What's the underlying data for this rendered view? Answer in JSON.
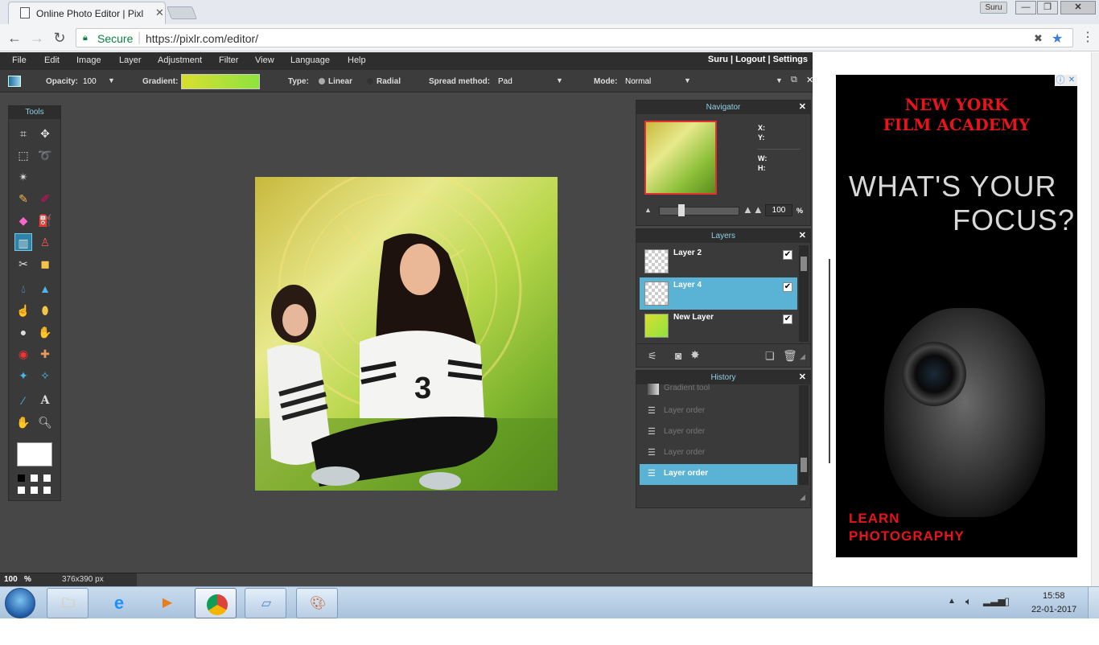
{
  "browser": {
    "tab_title": "Online Photo Editor | Pixl",
    "user": "Suru",
    "win_min": "—",
    "win_max": "❐",
    "win_close": "✕",
    "secure_label": "Secure",
    "url": "https://pixlr.com/editor/"
  },
  "menubar": {
    "items": [
      "File",
      "Edit",
      "Image",
      "Layer",
      "Adjustment",
      "Filter",
      "View",
      "Language",
      "Help"
    ],
    "user_links": "Suru  |  Logout  |  Settings"
  },
  "options": {
    "opacity_label": "Opacity:",
    "opacity_value": "100",
    "gradient_label": "Gradient:",
    "type_label": "Type:",
    "type_linear": "Linear",
    "type_radial": "Radial",
    "spread_label": "Spread method:",
    "spread_value": "Pad",
    "mode_label": "Mode:",
    "mode_value": "Normal"
  },
  "tools": {
    "title": "Tools"
  },
  "navigator": {
    "title": "Navigator",
    "x_label": "X:",
    "y_label": "Y:",
    "w_label": "W:",
    "h_label": "H:",
    "zoom_value": "100",
    "zoom_unit": "%"
  },
  "layers": {
    "title": "Layers",
    "items": [
      {
        "name": "Layer 2",
        "checked": "✔"
      },
      {
        "name": "Layer 4",
        "checked": "✔"
      },
      {
        "name": "New Layer",
        "checked": "✔"
      }
    ]
  },
  "history": {
    "title": "History",
    "items": [
      "Gradient tool",
      "Layer order",
      "Layer order",
      "Layer order",
      "Layer order"
    ]
  },
  "status": {
    "zoom": "100",
    "zoom_unit": "%",
    "doc_size": "376x390 px"
  },
  "ad": {
    "brand_line1": "NEW YORK",
    "brand_line2": "FILM ACADEMY",
    "headline_line1": "WHAT'S YOUR",
    "headline_line2": "FOCUS?",
    "cta_line1": "LEARN",
    "cta_line2": "PHOTOGRAPHY",
    "info_icon": "ⓘ",
    "close_icon": "✕"
  },
  "taskbar": {
    "time": "15:58",
    "date": "22-01-2017"
  },
  "colors": {
    "panel_accent": "#5ab2d4",
    "ad_red": "#e8141a"
  }
}
